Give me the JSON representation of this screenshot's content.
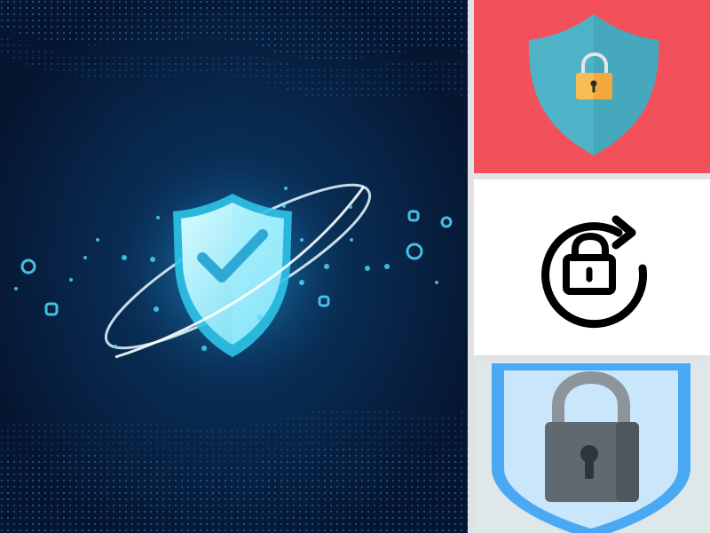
{
  "collage": {
    "main_image": {
      "subject": "security-shield-checkmark",
      "background_color": "#071d3c",
      "glow_color": "#3fd7ff",
      "shield_color": "#8ff0ff",
      "check_color": "#2ea9d6"
    },
    "red_tile": {
      "subject": "shield-padlock",
      "background_color": "#f2505a",
      "shield_color": "#4fb3c7",
      "lock_color": "#f2a93b"
    },
    "white_tile": {
      "subject": "refresh-padlock",
      "background_color": "#ffffff",
      "icon_color": "#000000"
    },
    "blue_tile": {
      "subject": "shield-padlock-keyhole",
      "background_color": "#dfe7ea",
      "shield_outer": "#4aa9f2",
      "shield_inner": "#c9e6fb",
      "lock_body": "#5f6a70",
      "lock_shackle": "#8b959b"
    }
  }
}
